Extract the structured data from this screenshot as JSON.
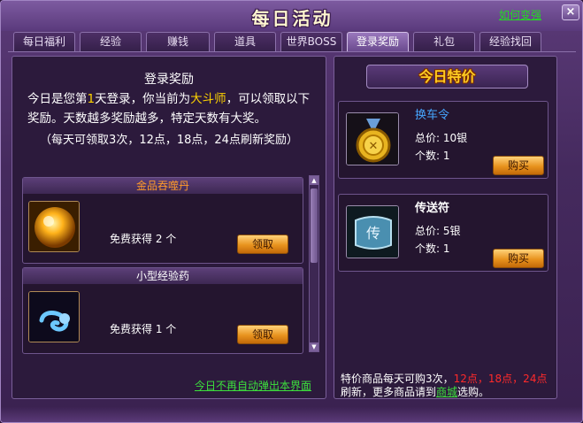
{
  "window": {
    "title": "每日活动",
    "how_link": "如何变强",
    "close_label": "×"
  },
  "tabs": [
    {
      "label": "每日福利"
    },
    {
      "label": "经验"
    },
    {
      "label": "赚钱"
    },
    {
      "label": "道具"
    },
    {
      "label": "世界BOSS"
    },
    {
      "label": "登录奖励"
    },
    {
      "label": "礼包"
    },
    {
      "label": "经验找回"
    }
  ],
  "active_tab": "登录奖励",
  "login": {
    "title": "登录奖励",
    "line1_a": "今日是您第",
    "day": "1",
    "line1_b": "天登录，你当前为",
    "rank": "大斗师",
    "line1_c": "，可以领取以下奖励。天数越多奖励越多，特定天数有大奖。",
    "note": "（每天可领取3次，12点，18点，24点刷新奖励）"
  },
  "rewards": [
    {
      "name": "金品吞噬丹",
      "name_color": "#ff9a2a",
      "icon": "golden-orb-icon",
      "desc": "免费获得 2 个",
      "button": "领取"
    },
    {
      "name": "小型经验药",
      "name_color": "#ffffff",
      "icon": "blue-wisp-icon",
      "desc": "免费获得 1 个",
      "button": "领取"
    }
  ],
  "no_popup": "今日不再自动弹出本界面",
  "special": {
    "title": "今日特价",
    "items": [
      {
        "name": "换车令",
        "name_color": "#46a6ff",
        "icon": "gold-medal-icon",
        "price": "总价: 10银",
        "count": "个数: 1",
        "button": "购买"
      },
      {
        "name": "传送符",
        "name_color": "#ffffff",
        "icon": "teleport-scroll-icon",
        "price": "总价: 5银",
        "count": "个数: 1",
        "button": "购买"
      }
    ]
  },
  "footer": {
    "part1": "特价商品每天可购3次，",
    "times": "12点，18点，24点",
    "part2": "刷新，更多商品请到",
    "shop": "商城",
    "part3": "选购。"
  }
}
